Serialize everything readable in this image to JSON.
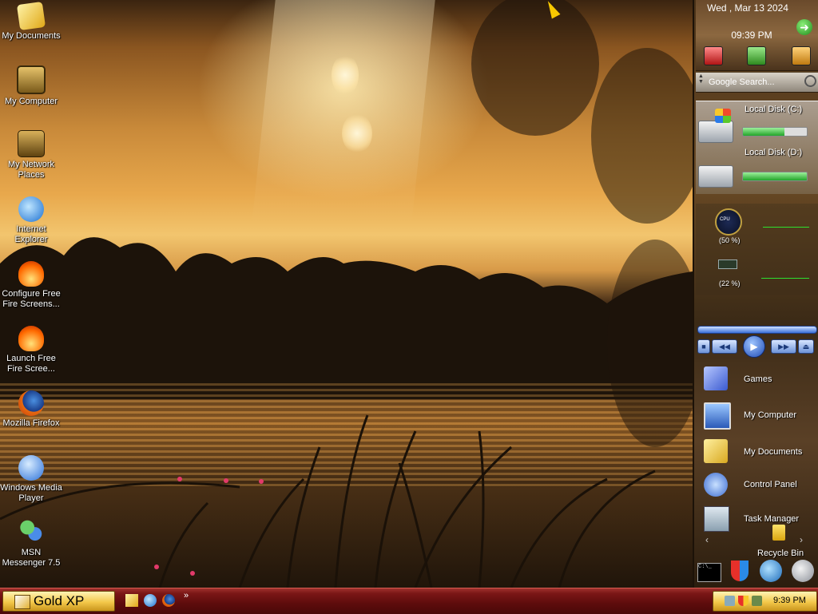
{
  "desktop": {
    "icons": [
      {
        "label": "My Documents",
        "icon": "folder-documents-icon"
      },
      {
        "label": "My Computer",
        "icon": "computer-icon"
      },
      {
        "label": "My Network Places",
        "icon": "network-icon"
      },
      {
        "label": "Internet Explorer",
        "icon": "ie-icon"
      },
      {
        "label": "Configure Free Fire Screens...",
        "icon": "fire-icon"
      },
      {
        "label": "Launch Free Fire Scree...",
        "icon": "fire-icon"
      },
      {
        "label": "Mozilla Firefox",
        "icon": "firefox-icon"
      },
      {
        "label": "Windows Media Player",
        "icon": "media-player-icon"
      },
      {
        "label": "MSN Messenger 7.5",
        "icon": "msn-icon"
      }
    ]
  },
  "sidebar": {
    "date": "Wed , Mar 13 2024",
    "time": "09:39 PM",
    "search_placeholder": "Google Search...",
    "drives": [
      {
        "label": "Local Disk (C:)",
        "used_fraction": 0.65
      },
      {
        "label": "Local Disk (D:)",
        "used_fraction": 1.0
      }
    ],
    "monitors": [
      {
        "name": "CPU",
        "percent": "(50 %)"
      },
      {
        "name": "RAM",
        "percent": "(22 %)"
      }
    ],
    "media_buttons": [
      "stop",
      "previous",
      "play",
      "next",
      "eject"
    ],
    "launch_items": [
      {
        "label": "Games",
        "icon": "games-folder-icon"
      },
      {
        "label": "My Computer",
        "icon": "computer-icon"
      },
      {
        "label": "My Documents",
        "icon": "documents-folder-icon"
      },
      {
        "label": "Control Panel",
        "icon": "control-panel-icon"
      },
      {
        "label": "Task Manager",
        "icon": "task-manager-icon"
      }
    ],
    "recycle_bin": "Recycle Bin"
  },
  "taskbar": {
    "start_label": "Gold XP",
    "overflow": "»",
    "clock": "9:39 PM"
  },
  "colors": {
    "taskbar": "#6a1010",
    "start_gold": "#f3c84a",
    "bar_green": "#23a42a"
  }
}
